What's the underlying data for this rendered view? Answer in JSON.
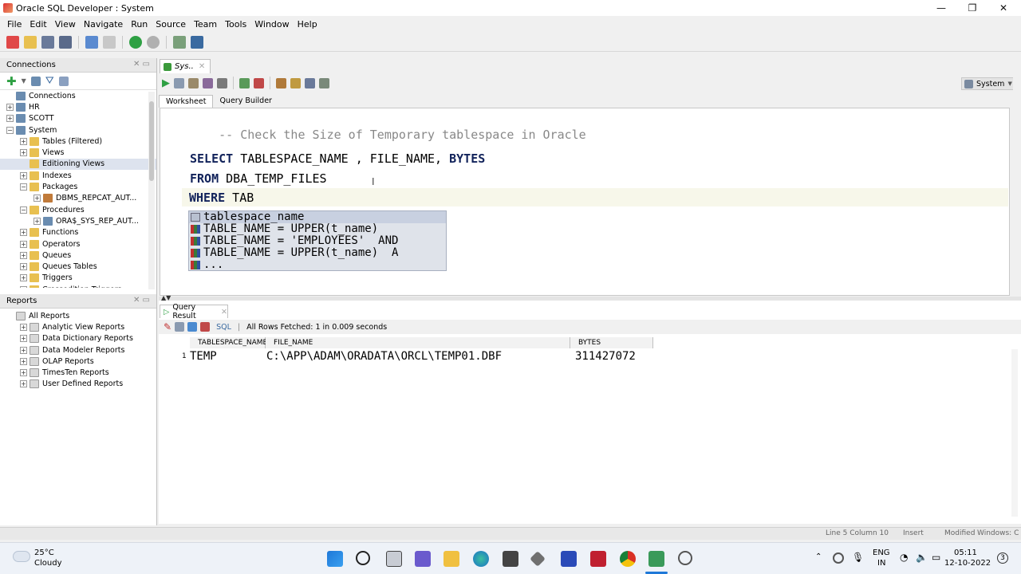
{
  "window": {
    "title": "Oracle SQL Developer : System",
    "controls": [
      "—",
      "❐",
      "✕"
    ]
  },
  "menu": [
    "File",
    "Edit",
    "View",
    "Navigate",
    "Run",
    "Source",
    "Team",
    "Tools",
    "Window",
    "Help"
  ],
  "connections_panel": {
    "title": "Connections",
    "tree": [
      {
        "label": "Connections",
        "level": 0,
        "expander": "",
        "icon": "db"
      },
      {
        "label": "HR",
        "level": 0,
        "expander": "+",
        "icon": "db"
      },
      {
        "label": "SCOTT",
        "level": 0,
        "expander": "+",
        "icon": "db"
      },
      {
        "label": "System",
        "level": 0,
        "expander": "−",
        "icon": "db"
      },
      {
        "label": "Tables (Filtered)",
        "level": 1,
        "expander": "+",
        "icon": "folder"
      },
      {
        "label": "Views",
        "level": 1,
        "expander": "+",
        "icon": "folder"
      },
      {
        "label": "Editioning Views",
        "level": 1,
        "expander": "",
        "icon": "folder",
        "selected": true
      },
      {
        "label": "Indexes",
        "level": 1,
        "expander": "+",
        "icon": "folder"
      },
      {
        "label": "Packages",
        "level": 1,
        "expander": "−",
        "icon": "folder"
      },
      {
        "label": "DBMS_REPCAT_AUT...",
        "level": 2,
        "expander": "+",
        "icon": "pkg"
      },
      {
        "label": "Procedures",
        "level": 1,
        "expander": "−",
        "icon": "folder"
      },
      {
        "label": "ORA$_SYS_REP_AUT...",
        "level": 2,
        "expander": "+",
        "icon": "db"
      },
      {
        "label": "Functions",
        "level": 1,
        "expander": "+",
        "icon": "folder"
      },
      {
        "label": "Operators",
        "level": 1,
        "expander": "+",
        "icon": "folder"
      },
      {
        "label": "Queues",
        "level": 1,
        "expander": "+",
        "icon": "folder"
      },
      {
        "label": "Queues Tables",
        "level": 1,
        "expander": "+",
        "icon": "folder"
      },
      {
        "label": "Triggers",
        "level": 1,
        "expander": "+",
        "icon": "folder"
      },
      {
        "label": "Crossedition Triggers",
        "level": 1,
        "expander": "+",
        "icon": "folder"
      }
    ]
  },
  "reports_panel": {
    "title": "Reports",
    "tree": [
      {
        "label": "All Reports",
        "level": 0,
        "expander": ""
      },
      {
        "label": "Analytic View Reports",
        "level": 1,
        "expander": "+"
      },
      {
        "label": "Data Dictionary Reports",
        "level": 1,
        "expander": "+"
      },
      {
        "label": "Data Modeler Reports",
        "level": 1,
        "expander": "+"
      },
      {
        "label": "OLAP Reports",
        "level": 1,
        "expander": "+"
      },
      {
        "label": "TimesTen Reports",
        "level": 1,
        "expander": "+"
      },
      {
        "label": "User Defined Reports",
        "level": 1,
        "expander": "+"
      }
    ]
  },
  "editor": {
    "doc_tab": "Sys..",
    "connection_selector": "System",
    "subtabs": [
      "Worksheet",
      "Query Builder"
    ],
    "lines": {
      "comment": "-- Check the Size of Temporary tablespace in Oracle",
      "select_kw": "SELECT",
      "select_cols": " TABLESPACE_NAME , FILE_NAME,",
      "bytes_kw": "BYTES",
      "from_kw": "FROM",
      "from_rest": " DBA_TEMP_FILES",
      "where_kw": "WHERE",
      "where_rest": " TAB"
    },
    "autocomplete": [
      {
        "text": "tablespace_name",
        "icon": "col"
      },
      {
        "text": "TABLE_NAME = UPPER(t_name)",
        "icon": "snip"
      },
      {
        "text": "TABLE_NAME = 'EMPLOYEES'  AND",
        "icon": "snip"
      },
      {
        "text": "TABLE_NAME = UPPER(t_name)  A",
        "icon": "snip"
      },
      {
        "text": "...",
        "icon": "snip"
      }
    ]
  },
  "results": {
    "tab": "Query Result",
    "sql_label": "SQL",
    "status": "All Rows Fetched: 1 in 0.009 seconds",
    "columns": [
      "TABLESPACE_NAME",
      "FILE_NAME",
      "BYTES"
    ],
    "rows": [
      {
        "num": "1",
        "cells": [
          "TEMP",
          "C:\\APP\\ADAM\\ORADATA\\ORCL\\TEMP01.DBF",
          "311427072"
        ]
      }
    ]
  },
  "statusbar": {
    "position": "Line 5 Column 10",
    "mode": "Insert",
    "modified": "Modified",
    "os": "Windows: C"
  },
  "taskbar": {
    "weather_temp": "25°C",
    "weather_desc": "Cloudy",
    "lang": "ENG",
    "region": "IN",
    "time": "05:11",
    "date": "12-10-2022",
    "notif_count": "3"
  }
}
